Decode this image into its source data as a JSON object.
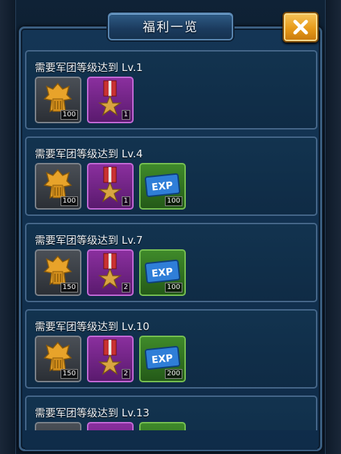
{
  "title": "福利一览",
  "close_icon": "close-x-icon",
  "rewards": [
    {
      "requirement": "需要军团等级达到 Lv.1",
      "items": [
        {
          "type": "eagle-badge",
          "qty": "100"
        },
        {
          "type": "medal",
          "qty": "1"
        }
      ]
    },
    {
      "requirement": "需要军团等级达到 Lv.4",
      "items": [
        {
          "type": "eagle-badge",
          "qty": "100"
        },
        {
          "type": "medal",
          "qty": "1"
        },
        {
          "type": "exp",
          "label": "EXP",
          "qty": "100"
        }
      ]
    },
    {
      "requirement": "需要军团等级达到 Lv.7",
      "items": [
        {
          "type": "eagle-badge",
          "qty": "150"
        },
        {
          "type": "medal",
          "qty": "2"
        },
        {
          "type": "exp",
          "label": "EXP",
          "qty": "100"
        }
      ]
    },
    {
      "requirement": "需要军团等级达到 Lv.10",
      "items": [
        {
          "type": "eagle-badge",
          "qty": "150"
        },
        {
          "type": "medal",
          "qty": "2"
        },
        {
          "type": "exp",
          "label": "EXP",
          "qty": "200"
        }
      ]
    },
    {
      "requirement": "需要军团等级达到 Lv.13",
      "items": [
        {
          "type": "eagle-badge",
          "qty": ""
        },
        {
          "type": "medal",
          "qty": ""
        },
        {
          "type": "exp",
          "label": "",
          "qty": ""
        }
      ]
    }
  ],
  "colors": {
    "panel": "#0f2c49",
    "eagle_slot": "#3a3f45",
    "medal_slot": "#7a2a8e",
    "exp_slot": "#2f7a22",
    "close_button": "#e79a1a"
  }
}
